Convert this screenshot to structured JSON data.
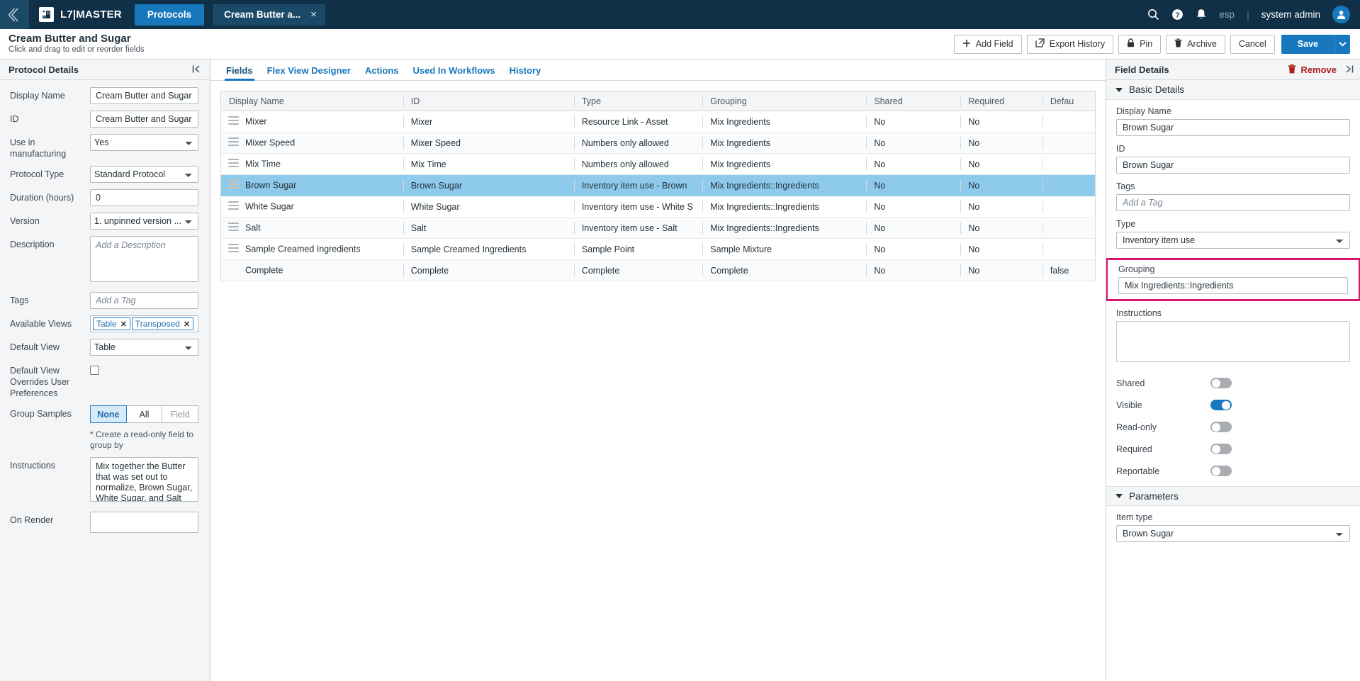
{
  "topnav": {
    "back_icon": "chevron-double-left-icon",
    "brand_logo_icon": "l7-building-icon",
    "brand_name": "L7|MASTER",
    "tab_protocols": "Protocols",
    "tab_document": "Cream Butter a...",
    "tab_document_close": "×",
    "search_icon": "search-icon",
    "help_icon": "help-circle-icon",
    "notification_icon": "bell-icon",
    "language": "esp",
    "divider": "|",
    "user": "system admin",
    "avatar_icon": "user-avatar-icon"
  },
  "actionbar": {
    "title": "Cream Butter and Sugar",
    "subtitle": "Click and drag to edit or reorder fields",
    "add_field": "Add Field",
    "add_field_icon": "plus-icon",
    "export_history": "Export History",
    "export_history_icon": "external-link-icon",
    "pin": "Pin",
    "pin_icon": "lock-icon",
    "archive": "Archive",
    "archive_icon": "trash-icon",
    "cancel": "Cancel",
    "save": "Save",
    "save_caret_icon": "chevron-down-icon"
  },
  "sidebar": {
    "header": "Protocol Details",
    "collapse_icon": "collapse-left-icon",
    "fields": {
      "display_name_label": "Display Name",
      "display_name_value": "Cream Butter and Sugar",
      "id_label": "ID",
      "id_value": "Cream Butter and Sugar",
      "use_in_manufacturing_label": "Use in manufacturing",
      "use_in_manufacturing_value": "Yes",
      "protocol_type_label": "Protocol Type",
      "protocol_type_value": "Standard Protocol",
      "duration_label": "Duration (hours)",
      "duration_value": "0",
      "version_label": "Version",
      "version_value": "1. unpinned version ...",
      "description_label": "Description",
      "description_placeholder": "Add a Description",
      "description_value": "",
      "tags_label": "Tags",
      "tags_placeholder": "Add a Tag",
      "available_views_label": "Available Views",
      "available_views_chips": [
        "Table",
        "Transposed"
      ],
      "chip_remove_icon": "✕",
      "default_view_label": "Default View",
      "default_view_value": "Table",
      "override_label": "Default View Overrides User Preferences",
      "override_checked": false,
      "group_samples_label": "Group Samples",
      "group_samples_options": [
        "None",
        "All",
        "Field"
      ],
      "group_samples_selected": "None",
      "group_samples_note": "* Create a read-only field to group by",
      "instructions_label": "Instructions",
      "instructions_value": "Mix together the Butter that was set out to normalize, Brown Sugar, White Sugar, and Salt",
      "on_render_label": "On Render",
      "on_render_value": ""
    }
  },
  "tabs": [
    {
      "label": "Fields",
      "active": true
    },
    {
      "label": "Flex View Designer",
      "active": false
    },
    {
      "label": "Actions",
      "active": false
    },
    {
      "label": "Used In Workflows",
      "active": false
    },
    {
      "label": "History",
      "active": false
    }
  ],
  "table": {
    "columns": [
      "Display Name",
      "ID",
      "Type",
      "Grouping",
      "Shared",
      "Required",
      "Defau"
    ],
    "rows": [
      {
        "handle": true,
        "selected": false,
        "display_name": "Mixer",
        "id": "Mixer",
        "type": "Resource Link - Asset",
        "grouping": "Mix Ingredients",
        "shared": "No",
        "required": "No",
        "default": ""
      },
      {
        "handle": true,
        "selected": false,
        "display_name": "Mixer Speed",
        "id": "Mixer Speed",
        "type": "Numbers only allowed",
        "grouping": "Mix Ingredients",
        "shared": "No",
        "required": "No",
        "default": ""
      },
      {
        "handle": true,
        "selected": false,
        "display_name": "Mix Time",
        "id": "Mix Time",
        "type": "Numbers only allowed",
        "grouping": "Mix Ingredients",
        "shared": "No",
        "required": "No",
        "default": ""
      },
      {
        "handle": true,
        "selected": true,
        "display_name": "Brown Sugar",
        "id": "Brown Sugar",
        "type": "Inventory item use - Brown ",
        "grouping": "Mix Ingredients::Ingredients",
        "shared": "No",
        "required": "No",
        "default": ""
      },
      {
        "handle": true,
        "selected": false,
        "display_name": "White Sugar",
        "id": "White Sugar",
        "type": "Inventory item use - White S",
        "grouping": "Mix Ingredients::Ingredients",
        "shared": "No",
        "required": "No",
        "default": ""
      },
      {
        "handle": true,
        "selected": false,
        "display_name": "Salt",
        "id": "Salt",
        "type": "Inventory item use - Salt",
        "grouping": "Mix Ingredients::Ingredients",
        "shared": "No",
        "required": "No",
        "default": ""
      },
      {
        "handle": true,
        "selected": false,
        "display_name": "Sample Creamed Ingredients",
        "id": "Sample Creamed Ingredients",
        "type": "Sample Point",
        "grouping": "Sample Mixture",
        "shared": "No",
        "required": "No",
        "default": ""
      },
      {
        "handle": false,
        "selected": false,
        "display_name": "Complete",
        "id": "Complete",
        "type": "Complete",
        "grouping": "Complete",
        "shared": "No",
        "required": "No",
        "default": "false"
      }
    ]
  },
  "right_panel": {
    "header": "Field Details",
    "remove_label": "Remove",
    "remove_icon": "trash-icon",
    "expand_icon": "collapse-right-icon",
    "basic_details_title": "Basic Details",
    "display_name_label": "Display Name",
    "display_name_value": "Brown Sugar",
    "id_label": "ID",
    "id_value": "Brown Sugar",
    "tags_label": "Tags",
    "tags_placeholder": "Add a Tag",
    "tags_value": "",
    "type_label": "Type",
    "type_value": "Inventory item use",
    "grouping_label": "Grouping",
    "grouping_value": "Mix Ingredients::Ingredients",
    "grouping_highlight_color": "#d6156e",
    "instructions_label": "Instructions",
    "instructions_value": "",
    "toggles": [
      {
        "label": "Shared",
        "on": false
      },
      {
        "label": "Visible",
        "on": true
      },
      {
        "label": "Read-only",
        "on": false
      },
      {
        "label": "Required",
        "on": false
      },
      {
        "label": "Reportable",
        "on": false
      }
    ],
    "parameters_title": "Parameters",
    "item_type_label": "Item type",
    "item_type_value": "Brown Sugar"
  },
  "colors": {
    "nav_bg": "#0f3047",
    "accent_blue": "#1878be",
    "selected_row": "#8ecaec",
    "highlight_pink": "#d6156e",
    "remove_red": "#b01c1c"
  }
}
